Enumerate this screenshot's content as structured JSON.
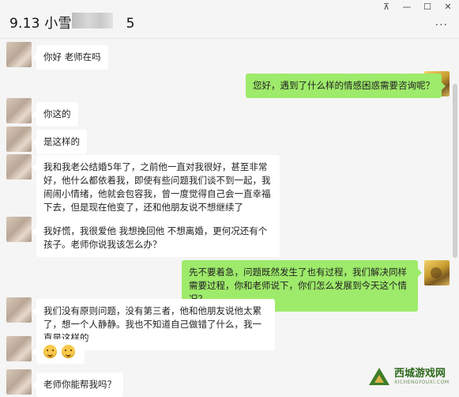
{
  "window": {
    "title_prefix": "9.13 小雪1",
    "title_suffix": "5",
    "controls": {
      "pin": "⊼",
      "minimize": "—",
      "maximize": "☐",
      "close": "✕"
    },
    "more_icon": "···"
  },
  "messages": [
    {
      "side": "in",
      "text": "你好 老师在吗"
    },
    {
      "side": "out",
      "text": "您好，遇到了什么样的情感困惑需要咨询呢？"
    },
    {
      "side": "in",
      "text": "你这的"
    },
    {
      "side": "in",
      "text": "是这样的"
    },
    {
      "side": "in",
      "text": "我和我老公结婚5年了，之前他一直对我很好，甚至非常好，他什么都依着我，即使有些问题我们谈不到一起，我闹闹小情绪，他就会包容我，曾一度觉得自己会一直幸福下去，但是现在他变了，还和他朋友说不想继续了"
    },
    {
      "side": "in",
      "text": "我好慌，我很爱他 我想挽回他 不想离婚，更何况还有个孩子。老师你说我该怎么办？"
    },
    {
      "side": "out",
      "text": "先不要着急，问题既然发生了也有过程，我们解决同样需要过程，你和老师说下，你们怎么发展到今天这个情况？"
    },
    {
      "side": "in",
      "text": "我们没有原则问题，没有第三者，他和他朋友说他太累了，想一个人静静。我也不知道自己做错了什么，我一直是这样的"
    },
    {
      "side": "in",
      "emoji": [
        "smile-emoji",
        "smile-emoji"
      ]
    },
    {
      "side": "in",
      "text": "老师你能帮我吗？"
    }
  ],
  "watermark": {
    "name": "西城游戏网",
    "sub": "XICHENGYOUXI.COM"
  }
}
